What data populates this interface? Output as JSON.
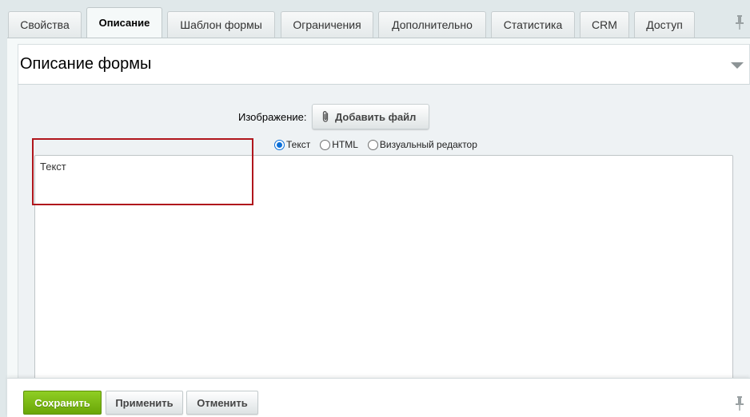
{
  "tabs": [
    {
      "label": "Свойства",
      "active": false
    },
    {
      "label": "Описание",
      "active": true
    },
    {
      "label": "Шаблон формы",
      "active": false
    },
    {
      "label": "Ограничения",
      "active": false
    },
    {
      "label": "Дополнительно",
      "active": false
    },
    {
      "label": "Статистика",
      "active": false
    },
    {
      "label": "CRM",
      "active": false
    },
    {
      "label": "Доступ",
      "active": false
    }
  ],
  "section": {
    "title": "Описание формы"
  },
  "image_field": {
    "label": "Изображение:",
    "button_label": "Добавить файл"
  },
  "editor_mode": {
    "options": [
      "Текст",
      "HTML",
      "Визуальный редактор"
    ],
    "selected": "Текст"
  },
  "description": {
    "value": "Текст"
  },
  "actions": {
    "save_label": "Сохранить",
    "apply_label": "Применить",
    "cancel_label": "Отменить"
  },
  "colors": {
    "accent_green": "#7bbd14",
    "highlight_red": "#b0161c",
    "radio_blue": "#0b6fd8"
  },
  "icons": [
    "pin-icon",
    "collapse-arrow-icon",
    "paperclip-icon"
  ]
}
